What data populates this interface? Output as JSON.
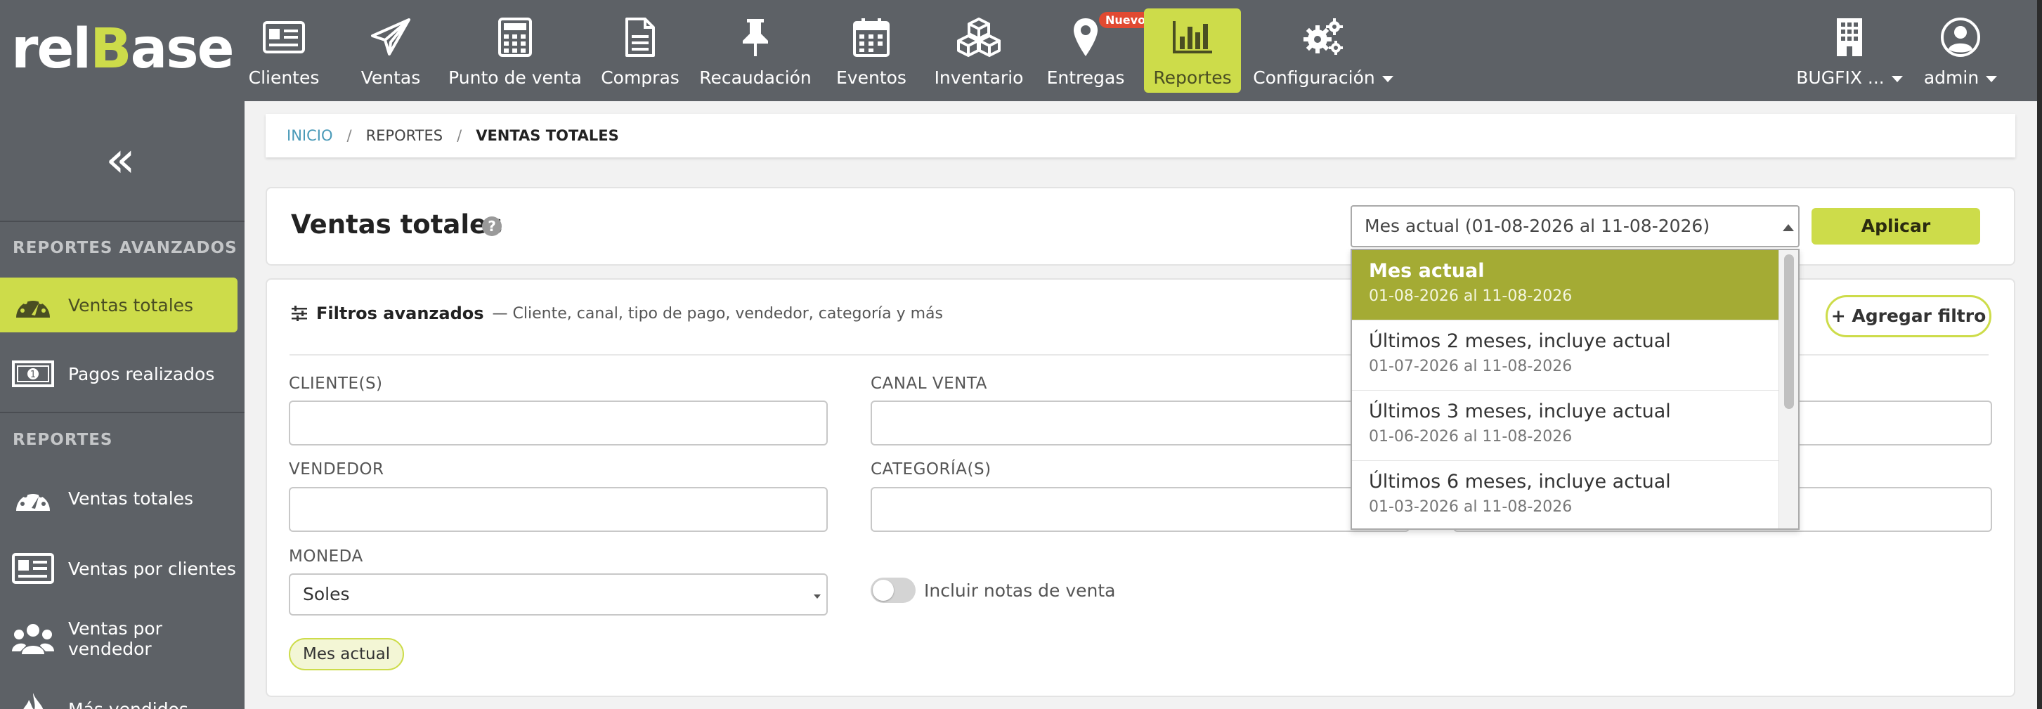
{
  "brand": {
    "logo_prefix": "rel",
    "logo_accent": "B",
    "logo_suffix": "ase"
  },
  "nav": {
    "items": [
      {
        "label": "Clientes",
        "icon": "id-card-icon"
      },
      {
        "label": "Ventas",
        "icon": "paper-plane-icon"
      },
      {
        "label": "Punto de venta",
        "icon": "calculator-icon"
      },
      {
        "label": "Compras",
        "icon": "document-icon"
      },
      {
        "label": "Recaudación",
        "icon": "pin-icon"
      },
      {
        "label": "Eventos",
        "icon": "calendar-icon"
      },
      {
        "label": "Inventario",
        "icon": "boxes-icon"
      },
      {
        "label": "Entregas",
        "icon": "map-marker-icon",
        "badge": "Nuevo"
      },
      {
        "label": "Reportes",
        "icon": "bar-chart-icon",
        "active": true
      },
      {
        "label": "Configuración",
        "icon": "gears-icon"
      }
    ],
    "company": "BUGFIX ...",
    "user": "admin"
  },
  "sidebar": {
    "section_advanced": "REPORTES AVANZADOS",
    "advanced_items": [
      {
        "label": "Ventas totales",
        "icon": "speedometer-icon",
        "active": true
      },
      {
        "label": "Pagos realizados",
        "icon": "banknote-icon"
      }
    ],
    "section_reports": "REPORTES",
    "report_items": [
      {
        "label": "Ventas totales",
        "icon": "speedometer-icon"
      },
      {
        "label": "Ventas por clientes",
        "icon": "id-card-icon"
      },
      {
        "label": "Ventas por vendedor",
        "icon": "users-icon"
      },
      {
        "label": "Más vendidos",
        "icon": "flame-icon"
      }
    ]
  },
  "breadcrumb": {
    "home": "INICIO",
    "section": "REPORTES",
    "current": "VENTAS TOTALES"
  },
  "header": {
    "title": "Ventas totales",
    "help": "?",
    "period_value": "Mes actual (01-08-2026 al 11-08-2026)",
    "apply_label": "Aplicar"
  },
  "filters": {
    "title": "Filtros avanzados",
    "description": "— Cliente, canal, tipo de pago, vendedor, categoría y más",
    "add_filter": "+ Agregar filtro",
    "fields": {
      "clientes": "CLIENTE(S)",
      "canal": "CANAL VENTA",
      "vendedor": "VENDEDOR",
      "categoria": "CATEGORÍA(S)",
      "moneda": "MONEDA"
    },
    "moneda_value": "Soles",
    "toggle_label": "Incluir notas de venta",
    "toggle_on": false,
    "active_chip": "Mes actual"
  },
  "period_options": [
    {
      "title": "Mes actual",
      "range": "01-08-2026 al 11-08-2026",
      "selected": true
    },
    {
      "title": "Últimos 2 meses, incluye actual",
      "range": "01-07-2026 al 11-08-2026"
    },
    {
      "title": "Últimos 3 meses, incluye actual",
      "range": "01-06-2026 al 11-08-2026"
    },
    {
      "title": "Últimos 6 meses, incluye actual",
      "range": "01-03-2026 al 11-08-2026"
    }
  ],
  "colors": {
    "accent": "#cddc4a",
    "selected_option": "#a4ab34",
    "chrome": "#5d6166",
    "link": "#4a9ab8"
  }
}
